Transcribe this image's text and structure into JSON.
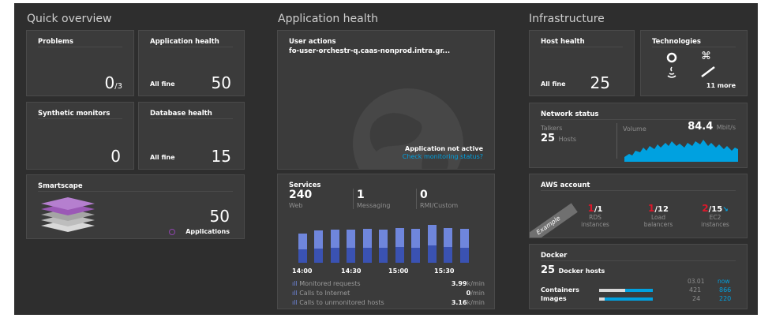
{
  "sections": {
    "overview": "Quick overview",
    "app_health": "Application health",
    "infra": "Infrastructure"
  },
  "problems": {
    "title": "Problems",
    "value": "0",
    "total": "/3"
  },
  "app_health_tile": {
    "title": "Application health",
    "status": "All fine",
    "value": "50"
  },
  "synthetic": {
    "title": "Synthetic monitors",
    "value": "0"
  },
  "db_health": {
    "title": "Database health",
    "status": "All fine",
    "value": "15"
  },
  "smartscape": {
    "title": "Smartscape",
    "value": "50",
    "label": "Applications"
  },
  "user_actions": {
    "title": "User actions",
    "app_name": "fo-user-orchestr-q.caas-nonprod.intra.gr...",
    "status": "Application not active",
    "link": "Check monitoring status?"
  },
  "services": {
    "title": "Services",
    "web_value": "240",
    "web_label": "Web",
    "messaging_value": "1",
    "messaging_label": "Messaging",
    "rmi_value": "0",
    "rmi_label": "RMI/Custom",
    "times": [
      "14:00",
      "14:30",
      "15:00",
      "15:30"
    ],
    "metrics": [
      {
        "label": "Monitored requests",
        "value": "3.99",
        "unit": "k/min"
      },
      {
        "label": "Calls to Internet",
        "value": "0",
        "unit": "/min"
      },
      {
        "label": "Calls to unmonitored hosts",
        "value": "3.16",
        "unit": "k/min"
      }
    ],
    "bars": [
      0.62,
      0.68,
      0.7,
      0.7,
      0.72,
      0.7,
      0.74,
      0.72,
      0.8,
      0.74,
      0.72
    ]
  },
  "host_health": {
    "title": "Host health",
    "status": "All fine",
    "value": "25"
  },
  "technologies": {
    "title": "Technologies",
    "more": "11 more",
    "icons": [
      "openshift-icon",
      "dragon-icon",
      "java-icon",
      "feather-icon"
    ]
  },
  "network": {
    "title": "Network status",
    "talkers_label": "Talkers",
    "talkers_value": "25",
    "hosts_label": "Hosts",
    "volume_label": "Volume",
    "volume_value": "84.4",
    "volume_unit": "Mbit/s"
  },
  "aws": {
    "title": "AWS account",
    "badge": "Example",
    "items": [
      {
        "value": "1",
        "total": "/1",
        "label1": "RDS",
        "label2": "instances"
      },
      {
        "value": "1",
        "total": "/12",
        "label1": "Load",
        "label2": "balancers"
      },
      {
        "value": "2",
        "total": "/15",
        "label1": "EC2",
        "label2": "instances"
      }
    ]
  },
  "docker": {
    "title": "Docker",
    "hosts_value": "25",
    "hosts_label": "Docker hosts",
    "col1": "03.01",
    "col2": "now",
    "rows": [
      {
        "label": "Containers",
        "v1": "421",
        "v2": "866",
        "fill": 0.49
      },
      {
        "label": "Images",
        "v1": "24",
        "v2": "220",
        "fill": 0.11
      }
    ]
  },
  "colors": {
    "accent": "#00a1e0",
    "bar_light": "#6f86dc",
    "bar_dark": "#3a52b2",
    "alert": "#dc172a",
    "purple": "#8e44ad"
  }
}
